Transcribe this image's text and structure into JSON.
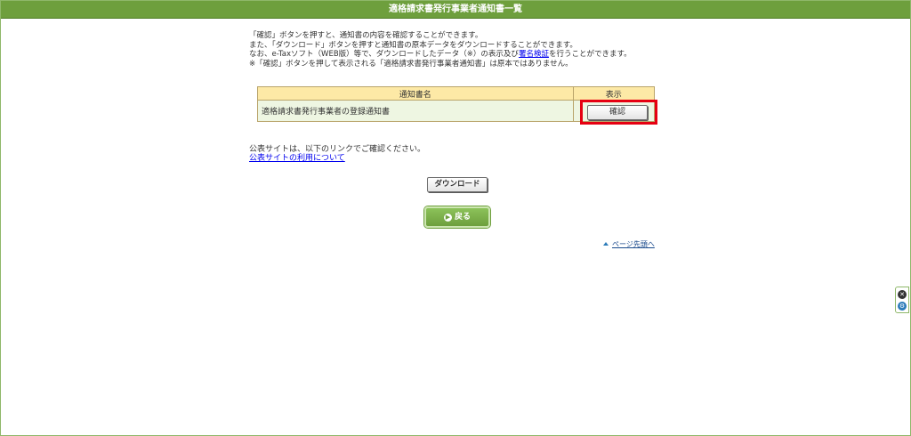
{
  "header": {
    "title": "適格請求書発行事業者通知書一覧"
  },
  "notes": {
    "line1": "「確認」ボタンを押すと、通知書の内容を確認することができます。",
    "line2": "また、「ダウンロード」ボタンを押すと通知書の原本データをダウンロードすることができます。",
    "line3_before": "なお、e-Taxソフト（WEB版）等で、ダウンロードしたデータ（※）の表示及び",
    "line3_link": "署名検証",
    "line3_after": "を行うことができます。",
    "line4": "※「確認」ボタンを押して表示される「適格請求書発行事業者通知書」は原本ではありません。"
  },
  "table": {
    "headers": {
      "name": "通知書名",
      "action": "表示"
    },
    "rows": [
      {
        "name": "適格請求書発行事業者の登録通知書",
        "action_label": "確認"
      }
    ]
  },
  "publish": {
    "text": "公表サイトは、以下のリンクでご確認ください。",
    "link": "公表サイトの利用について"
  },
  "buttons": {
    "download": "ダウンロード",
    "back": "戻る"
  },
  "page_top": {
    "label": "ページ先頭へ"
  },
  "colors": {
    "header_green": "#6e9f3d",
    "table_header": "#fde9a6",
    "table_row": "#eef6e2",
    "highlight_red": "#e60012",
    "link_blue": "#0000ee"
  },
  "icons": [
    "arrow-right-circle-icon",
    "up-arrow-icon",
    "close-icon",
    "gear-icon"
  ]
}
